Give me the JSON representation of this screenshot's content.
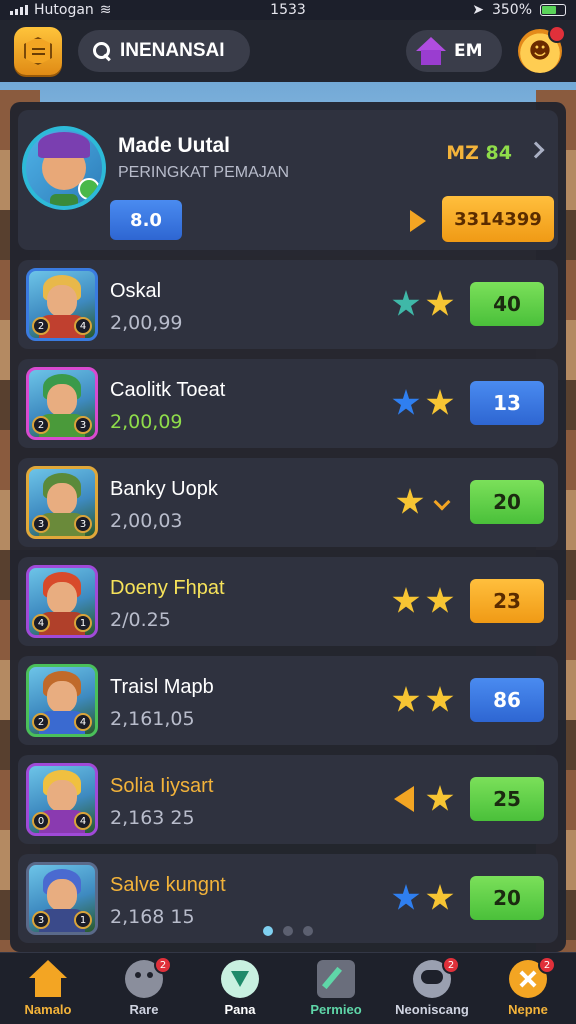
{
  "status": {
    "carrier": "Hutogan",
    "time": "1533",
    "battery": "350%"
  },
  "topbar": {
    "search_text": "INENANSAI",
    "home_label": "EM"
  },
  "profile": {
    "name": "Made Uutal",
    "subtitle": "PERINGKAT PEMAJAN",
    "score_prefix": "MZ",
    "score_value": "84",
    "level": "8.0",
    "coins": "3314399"
  },
  "players": [
    {
      "name": "Oskal",
      "score": "2,00,99",
      "stars": [
        "teal",
        "gold"
      ],
      "value": "40",
      "value_color": "green",
      "frame": "#3a7be0",
      "hair": "#e8b84a",
      "body": "#c0402f",
      "badges": [
        "2",
        "4"
      ]
    },
    {
      "name": "Caolitk Toeat",
      "score": "2,00,09",
      "stars": [
        "blue",
        "gold"
      ],
      "value": "13",
      "value_color": "blue",
      "frame": "#d84ad0",
      "hair": "#3a9a4a",
      "body": "#4a9a3a",
      "badges": [
        "2",
        "3"
      ],
      "score_color": "#8fdc4a"
    },
    {
      "name": "Banky Uopk",
      "score": "2,00,03",
      "stars": [
        "gold",
        "chevron"
      ],
      "value": "20",
      "value_color": "green",
      "frame": "#e0a83a",
      "hair": "#5a8a3a",
      "body": "#6a8a3a",
      "badges": [
        "3",
        "3"
      ]
    },
    {
      "name": "Doeny Fhpat",
      "score": "2/0.25",
      "stars": [
        "gold",
        "gold"
      ],
      "value": "23",
      "value_color": "orange",
      "frame": "#a04ad8",
      "hair": "#d84a2a",
      "body": "#b0402a",
      "badges": [
        "4",
        "1"
      ],
      "name_color": "#f7e35a"
    },
    {
      "name": "Traisl Mapb",
      "score": "2,161,05",
      "stars": [
        "gold",
        "gold"
      ],
      "value": "86",
      "value_color": "blue",
      "frame": "#4ac05a",
      "hair": "#c06a2a",
      "body": "#3a6ad0",
      "badges": [
        "2",
        "4"
      ]
    },
    {
      "name": "Solia Iiysart",
      "score": "2,163 25",
      "stars": [
        "arrow",
        "gold"
      ],
      "value": "25",
      "value_color": "green",
      "frame": "#a04ad8",
      "hair": "#f0c040",
      "body": "#8a3ab0",
      "badges": [
        "0",
        "4"
      ],
      "name_color": "#f3b33a"
    },
    {
      "name": "Salve kungnt",
      "score": "2,168 15",
      "stars": [
        "blue",
        "gold"
      ],
      "value": "20",
      "value_color": "green",
      "frame": "#5a6a8a",
      "hair": "#4a6ad0",
      "body": "#3a4a8a",
      "badges": [
        "3",
        "1"
      ],
      "name_color": "#f3b33a"
    }
  ],
  "pagination": {
    "count": 3,
    "active": 0
  },
  "tabs": [
    {
      "label": "Namalo",
      "icon": "home-icon",
      "cls": "home",
      "label_color": "gold",
      "notif": ""
    },
    {
      "label": "Rare",
      "icon": "ghost-icon",
      "cls": "ghost",
      "label_color": "",
      "notif": "2"
    },
    {
      "label": "Pana",
      "icon": "triangle-icon",
      "cls": "tri",
      "label_color": "white",
      "notif": ""
    },
    {
      "label": "Permieo",
      "icon": "edit-icon",
      "cls": "edit",
      "label_color": "green",
      "notif": ""
    },
    {
      "label": "Neoniscang",
      "icon": "chat-icon",
      "cls": "chat",
      "label_color": "",
      "notif": "2"
    },
    {
      "label": "Nepne",
      "icon": "close-icon",
      "cls": "close",
      "label_color": "gold",
      "notif": "2"
    }
  ]
}
